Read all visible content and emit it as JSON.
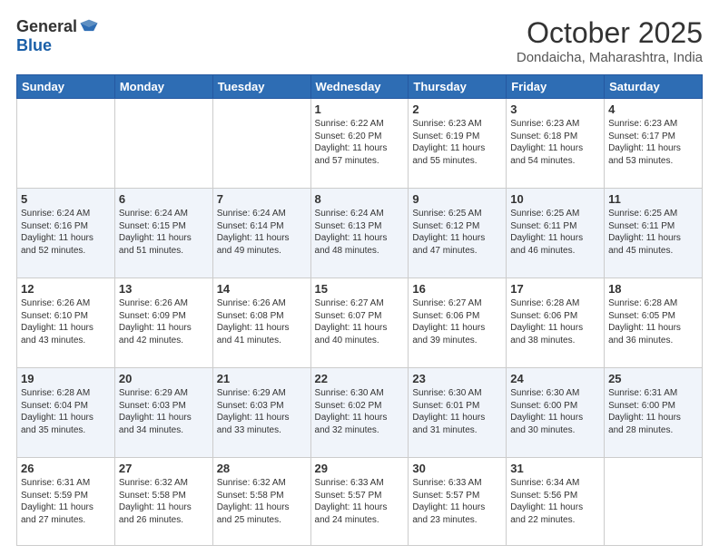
{
  "header": {
    "logo_general": "General",
    "logo_blue": "Blue",
    "month": "October 2025",
    "location": "Dondaicha, Maharashtra, India"
  },
  "weekdays": [
    "Sunday",
    "Monday",
    "Tuesday",
    "Wednesday",
    "Thursday",
    "Friday",
    "Saturday"
  ],
  "weeks": [
    [
      {
        "day": "",
        "info": ""
      },
      {
        "day": "",
        "info": ""
      },
      {
        "day": "",
        "info": ""
      },
      {
        "day": "1",
        "info": "Sunrise: 6:22 AM\nSunset: 6:20 PM\nDaylight: 11 hours\nand 57 minutes."
      },
      {
        "day": "2",
        "info": "Sunrise: 6:23 AM\nSunset: 6:19 PM\nDaylight: 11 hours\nand 55 minutes."
      },
      {
        "day": "3",
        "info": "Sunrise: 6:23 AM\nSunset: 6:18 PM\nDaylight: 11 hours\nand 54 minutes."
      },
      {
        "day": "4",
        "info": "Sunrise: 6:23 AM\nSunset: 6:17 PM\nDaylight: 11 hours\nand 53 minutes."
      }
    ],
    [
      {
        "day": "5",
        "info": "Sunrise: 6:24 AM\nSunset: 6:16 PM\nDaylight: 11 hours\nand 52 minutes."
      },
      {
        "day": "6",
        "info": "Sunrise: 6:24 AM\nSunset: 6:15 PM\nDaylight: 11 hours\nand 51 minutes."
      },
      {
        "day": "7",
        "info": "Sunrise: 6:24 AM\nSunset: 6:14 PM\nDaylight: 11 hours\nand 49 minutes."
      },
      {
        "day": "8",
        "info": "Sunrise: 6:24 AM\nSunset: 6:13 PM\nDaylight: 11 hours\nand 48 minutes."
      },
      {
        "day": "9",
        "info": "Sunrise: 6:25 AM\nSunset: 6:12 PM\nDaylight: 11 hours\nand 47 minutes."
      },
      {
        "day": "10",
        "info": "Sunrise: 6:25 AM\nSunset: 6:11 PM\nDaylight: 11 hours\nand 46 minutes."
      },
      {
        "day": "11",
        "info": "Sunrise: 6:25 AM\nSunset: 6:11 PM\nDaylight: 11 hours\nand 45 minutes."
      }
    ],
    [
      {
        "day": "12",
        "info": "Sunrise: 6:26 AM\nSunset: 6:10 PM\nDaylight: 11 hours\nand 43 minutes."
      },
      {
        "day": "13",
        "info": "Sunrise: 6:26 AM\nSunset: 6:09 PM\nDaylight: 11 hours\nand 42 minutes."
      },
      {
        "day": "14",
        "info": "Sunrise: 6:26 AM\nSunset: 6:08 PM\nDaylight: 11 hours\nand 41 minutes."
      },
      {
        "day": "15",
        "info": "Sunrise: 6:27 AM\nSunset: 6:07 PM\nDaylight: 11 hours\nand 40 minutes."
      },
      {
        "day": "16",
        "info": "Sunrise: 6:27 AM\nSunset: 6:06 PM\nDaylight: 11 hours\nand 39 minutes."
      },
      {
        "day": "17",
        "info": "Sunrise: 6:28 AM\nSunset: 6:06 PM\nDaylight: 11 hours\nand 38 minutes."
      },
      {
        "day": "18",
        "info": "Sunrise: 6:28 AM\nSunset: 6:05 PM\nDaylight: 11 hours\nand 36 minutes."
      }
    ],
    [
      {
        "day": "19",
        "info": "Sunrise: 6:28 AM\nSunset: 6:04 PM\nDaylight: 11 hours\nand 35 minutes."
      },
      {
        "day": "20",
        "info": "Sunrise: 6:29 AM\nSunset: 6:03 PM\nDaylight: 11 hours\nand 34 minutes."
      },
      {
        "day": "21",
        "info": "Sunrise: 6:29 AM\nSunset: 6:03 PM\nDaylight: 11 hours\nand 33 minutes."
      },
      {
        "day": "22",
        "info": "Sunrise: 6:30 AM\nSunset: 6:02 PM\nDaylight: 11 hours\nand 32 minutes."
      },
      {
        "day": "23",
        "info": "Sunrise: 6:30 AM\nSunset: 6:01 PM\nDaylight: 11 hours\nand 31 minutes."
      },
      {
        "day": "24",
        "info": "Sunrise: 6:30 AM\nSunset: 6:00 PM\nDaylight: 11 hours\nand 30 minutes."
      },
      {
        "day": "25",
        "info": "Sunrise: 6:31 AM\nSunset: 6:00 PM\nDaylight: 11 hours\nand 28 minutes."
      }
    ],
    [
      {
        "day": "26",
        "info": "Sunrise: 6:31 AM\nSunset: 5:59 PM\nDaylight: 11 hours\nand 27 minutes."
      },
      {
        "day": "27",
        "info": "Sunrise: 6:32 AM\nSunset: 5:58 PM\nDaylight: 11 hours\nand 26 minutes."
      },
      {
        "day": "28",
        "info": "Sunrise: 6:32 AM\nSunset: 5:58 PM\nDaylight: 11 hours\nand 25 minutes."
      },
      {
        "day": "29",
        "info": "Sunrise: 6:33 AM\nSunset: 5:57 PM\nDaylight: 11 hours\nand 24 minutes."
      },
      {
        "day": "30",
        "info": "Sunrise: 6:33 AM\nSunset: 5:57 PM\nDaylight: 11 hours\nand 23 minutes."
      },
      {
        "day": "31",
        "info": "Sunrise: 6:34 AM\nSunset: 5:56 PM\nDaylight: 11 hours\nand 22 minutes."
      },
      {
        "day": "",
        "info": ""
      }
    ]
  ]
}
